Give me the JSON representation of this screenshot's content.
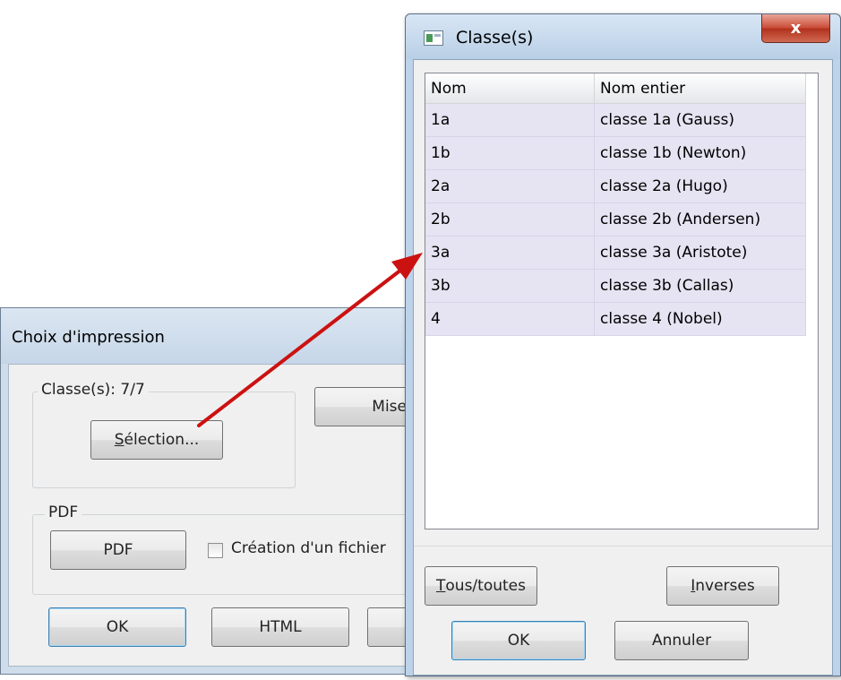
{
  "print_dialog": {
    "title": "Choix d'impression",
    "group_classes_label": "Classe(s): 7/7",
    "selection_button": {
      "prefix": "",
      "accel": "S",
      "rest": "élection..."
    },
    "mise_button_label": "Mise",
    "group_pdf_label": "PDF",
    "pdf_button_label": "PDF",
    "create_file_checkbox_label": "Création d'un fichier",
    "create_file_checked": false,
    "ok_button_label": "OK",
    "html_button_label": "HTML"
  },
  "classes_dialog": {
    "title": "Classe(s)",
    "close_label": "x",
    "columns": [
      "Nom",
      "Nom entier"
    ],
    "rows": [
      [
        "1a",
        "classe 1a (Gauss)"
      ],
      [
        "1b",
        "classe 1b (Newton)"
      ],
      [
        "2a",
        "classe 2a (Hugo)"
      ],
      [
        "2b",
        "classe 2b (Andersen)"
      ],
      [
        "3a",
        "classe 3a (Aristote)"
      ],
      [
        "3b",
        "classe 3b (Callas)"
      ],
      [
        "4",
        "classe 4 (Nobel)"
      ]
    ],
    "all_button": {
      "accel": "T",
      "rest": "ous/toutes"
    },
    "invert_button": {
      "accel": "I",
      "rest": "nverses"
    },
    "ok_button_label": "OK",
    "cancel_button_label": "Annuler"
  },
  "colors": {
    "row_selected_bg": "#e6e3f2",
    "arrow": "#cc1111",
    "close_button": "#c94a36"
  }
}
